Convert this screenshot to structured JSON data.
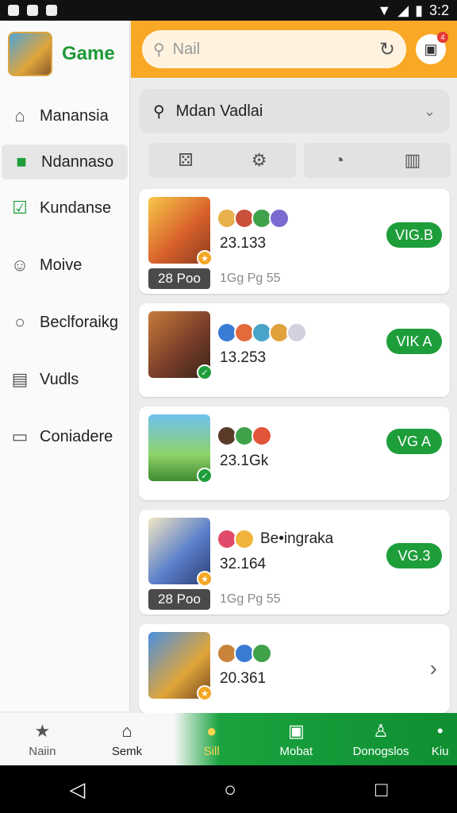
{
  "status": {
    "time": "3:2"
  },
  "sidebar": {
    "brand": "Game",
    "items": [
      {
        "label": "Manansia",
        "icon": "tag-icon"
      },
      {
        "label": "Ndannaso",
        "icon": "bag-icon",
        "active": true
      },
      {
        "label": "Kundanse",
        "icon": "check-icon"
      },
      {
        "label": "Moive",
        "icon": "person-icon"
      },
      {
        "label": "Beclforaikg",
        "icon": "search-icon"
      },
      {
        "label": "Vudls",
        "icon": "doc-icon"
      },
      {
        "label": "Coniadere",
        "icon": "card-icon"
      }
    ]
  },
  "topbar": {
    "search_placeholder": "Nail",
    "cart_badge": "4"
  },
  "filter": {
    "label": "Mdan Vadlai"
  },
  "cards": [
    {
      "stat": "23.133",
      "action": "VIG.B",
      "price": "28 Poo",
      "meta": "1Gg Pg 55",
      "extra": ""
    },
    {
      "stat": "13.253",
      "action": "VIK A",
      "price": "",
      "meta": "",
      "extra": ""
    },
    {
      "stat": "23.1Gk",
      "action": "VG A",
      "price": "",
      "meta": "",
      "extra": ""
    },
    {
      "stat": "32.164",
      "action": "VG.3",
      "price": "28 Poo",
      "meta": "1Gg Pg 55",
      "extra": "Be•ingraka"
    },
    {
      "stat": "20.361",
      "action": "",
      "price": "",
      "meta": "",
      "extra": ""
    }
  ],
  "tabs": [
    {
      "label": "Naiin",
      "icon": "star-icon"
    },
    {
      "label": "Semk",
      "icon": "home-icon"
    },
    {
      "label": "Sill",
      "icon": "leaf-icon",
      "active": true
    },
    {
      "label": "Mobat",
      "icon": "bag-icon"
    },
    {
      "label": "Donogslos",
      "icon": "user-icon"
    },
    {
      "label": "Kiu",
      "icon": "more-icon"
    }
  ],
  "colors": {
    "accent": "#f9a825",
    "green": "#1e9e3b"
  }
}
